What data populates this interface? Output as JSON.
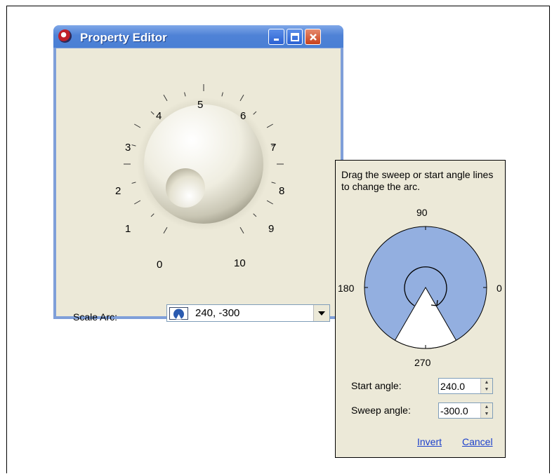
{
  "window": {
    "title": "Property Editor",
    "controls": {
      "minimize": "minimize-icon",
      "maximize": "maximize-icon",
      "close": "close-icon"
    }
  },
  "dial": {
    "tick_labels": [
      "0",
      "1",
      "2",
      "3",
      "4",
      "5",
      "6",
      "7",
      "8",
      "9",
      "10"
    ]
  },
  "scale_arc": {
    "label": "Scale Arc:",
    "value": "240, -300"
  },
  "arc_editor": {
    "help_text": "Drag the sweep or start angle lines to change the arc.",
    "angle_labels": {
      "top": "90",
      "left": "180",
      "right": "0",
      "bottom": "270"
    },
    "start_angle_label": "Start angle:",
    "start_angle_value": "240.0",
    "sweep_angle_label": "Sweep angle:",
    "sweep_angle_value": "-300.0",
    "invert_label": "Invert",
    "cancel_label": "Cancel",
    "arc_color": "#93afe0"
  }
}
